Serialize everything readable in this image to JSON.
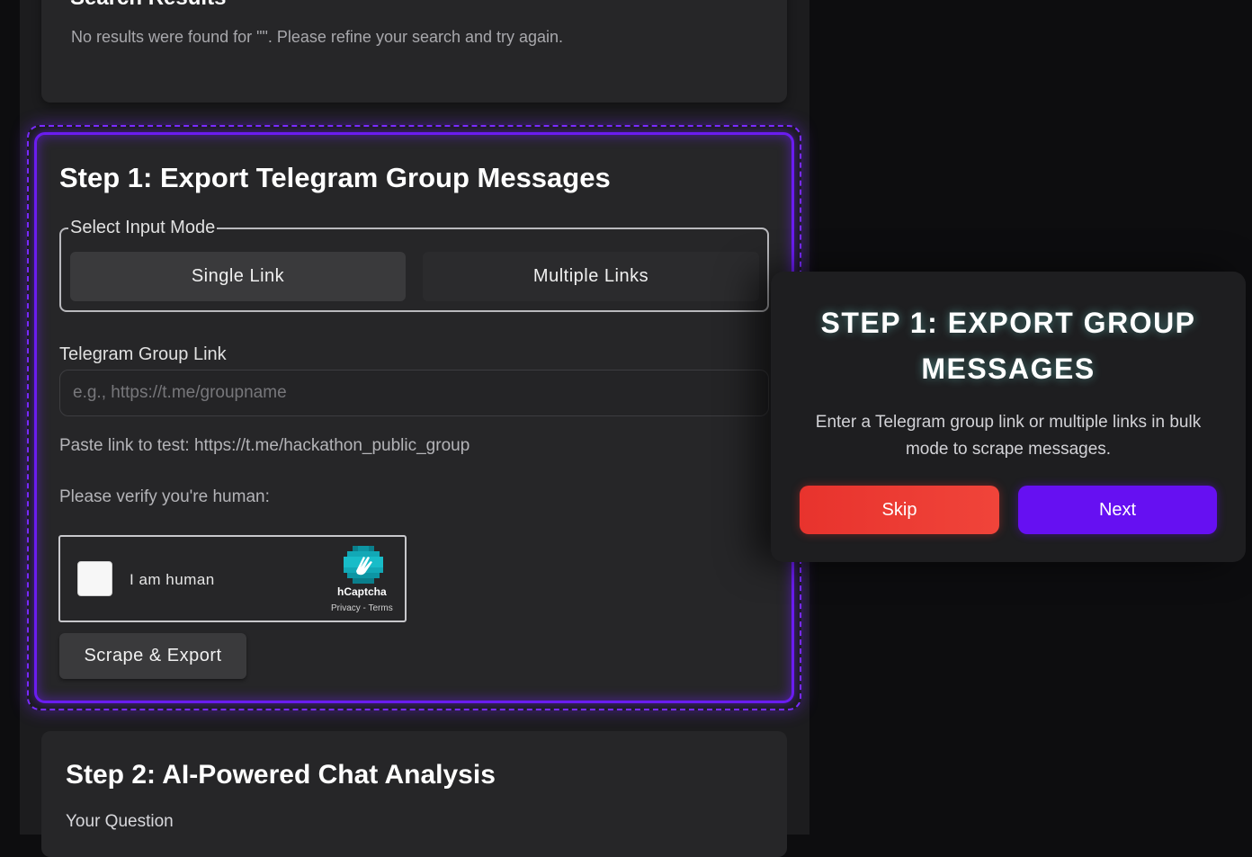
{
  "search_results": {
    "title": "Search Results",
    "message": "No results were found for \"\". Please refine your search and try again."
  },
  "step1": {
    "title": "Step 1: Export Telegram Group Messages",
    "mode_legend": "Select Input Mode",
    "mode_options": [
      "Single Link",
      "Multiple Links"
    ],
    "link_label": "Telegram Group Link",
    "link_placeholder": "e.g., https://t.me/groupname",
    "link_value": "",
    "hint": "Paste link to test: https://t.me/hackathon_public_group",
    "verify_label": "Please verify you're human:",
    "captcha": {
      "label": "I am human",
      "brand": "hCaptcha",
      "links": "Privacy - Terms"
    },
    "scrape_button": "Scrape & Export"
  },
  "step2": {
    "title": "Step 2: AI-Powered Chat Analysis",
    "question_label": "Your Question"
  },
  "tour": {
    "title": "STEP 1: EXPORT GROUP MESSAGES",
    "description": "Enter a Telegram group link or multiple links in bulk mode to scrape messages.",
    "skip_label": "Skip",
    "next_label": "Next"
  },
  "colors": {
    "accent_purple": "#6a1cf0",
    "skip_red": "#e8332d",
    "next_purple": "#6610f2"
  }
}
